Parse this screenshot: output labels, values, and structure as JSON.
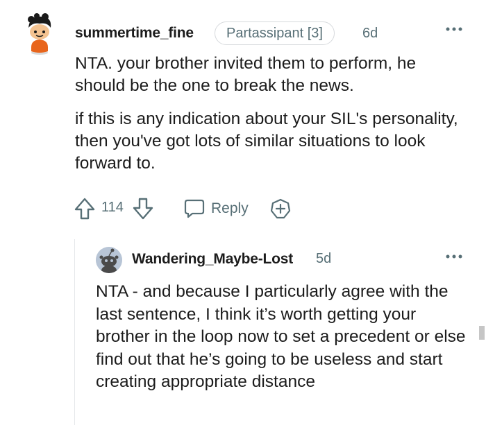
{
  "comment": {
    "author": "summertime_fine",
    "flair": "Partassipant [3]",
    "age": "6d",
    "paragraphs": [
      "NTA. your brother invited them to perform, he should be the one to break the news.",
      "if this is any indication about your SIL's personality, then you've got lots of similar situations to look forward to."
    ],
    "score": "114",
    "reply_label": "Reply",
    "icons": {
      "upvote": "upvote-icon",
      "downvote": "downvote-icon",
      "reply": "reply-icon",
      "award": "award-icon",
      "more": "more-options-icon"
    }
  },
  "reply": {
    "author": "Wandering_Maybe-Lost",
    "age": "5d",
    "text": "NTA - and because I particularly agree with the last sentence, I think it’s worth getting your brother in the loop now to set a precedent or else find out that he’s going to be useless and start creating appropriate distance"
  },
  "colors": {
    "text": "#1c1c1c",
    "meta": "#576f76",
    "avatar_orange": "#e8651c"
  }
}
